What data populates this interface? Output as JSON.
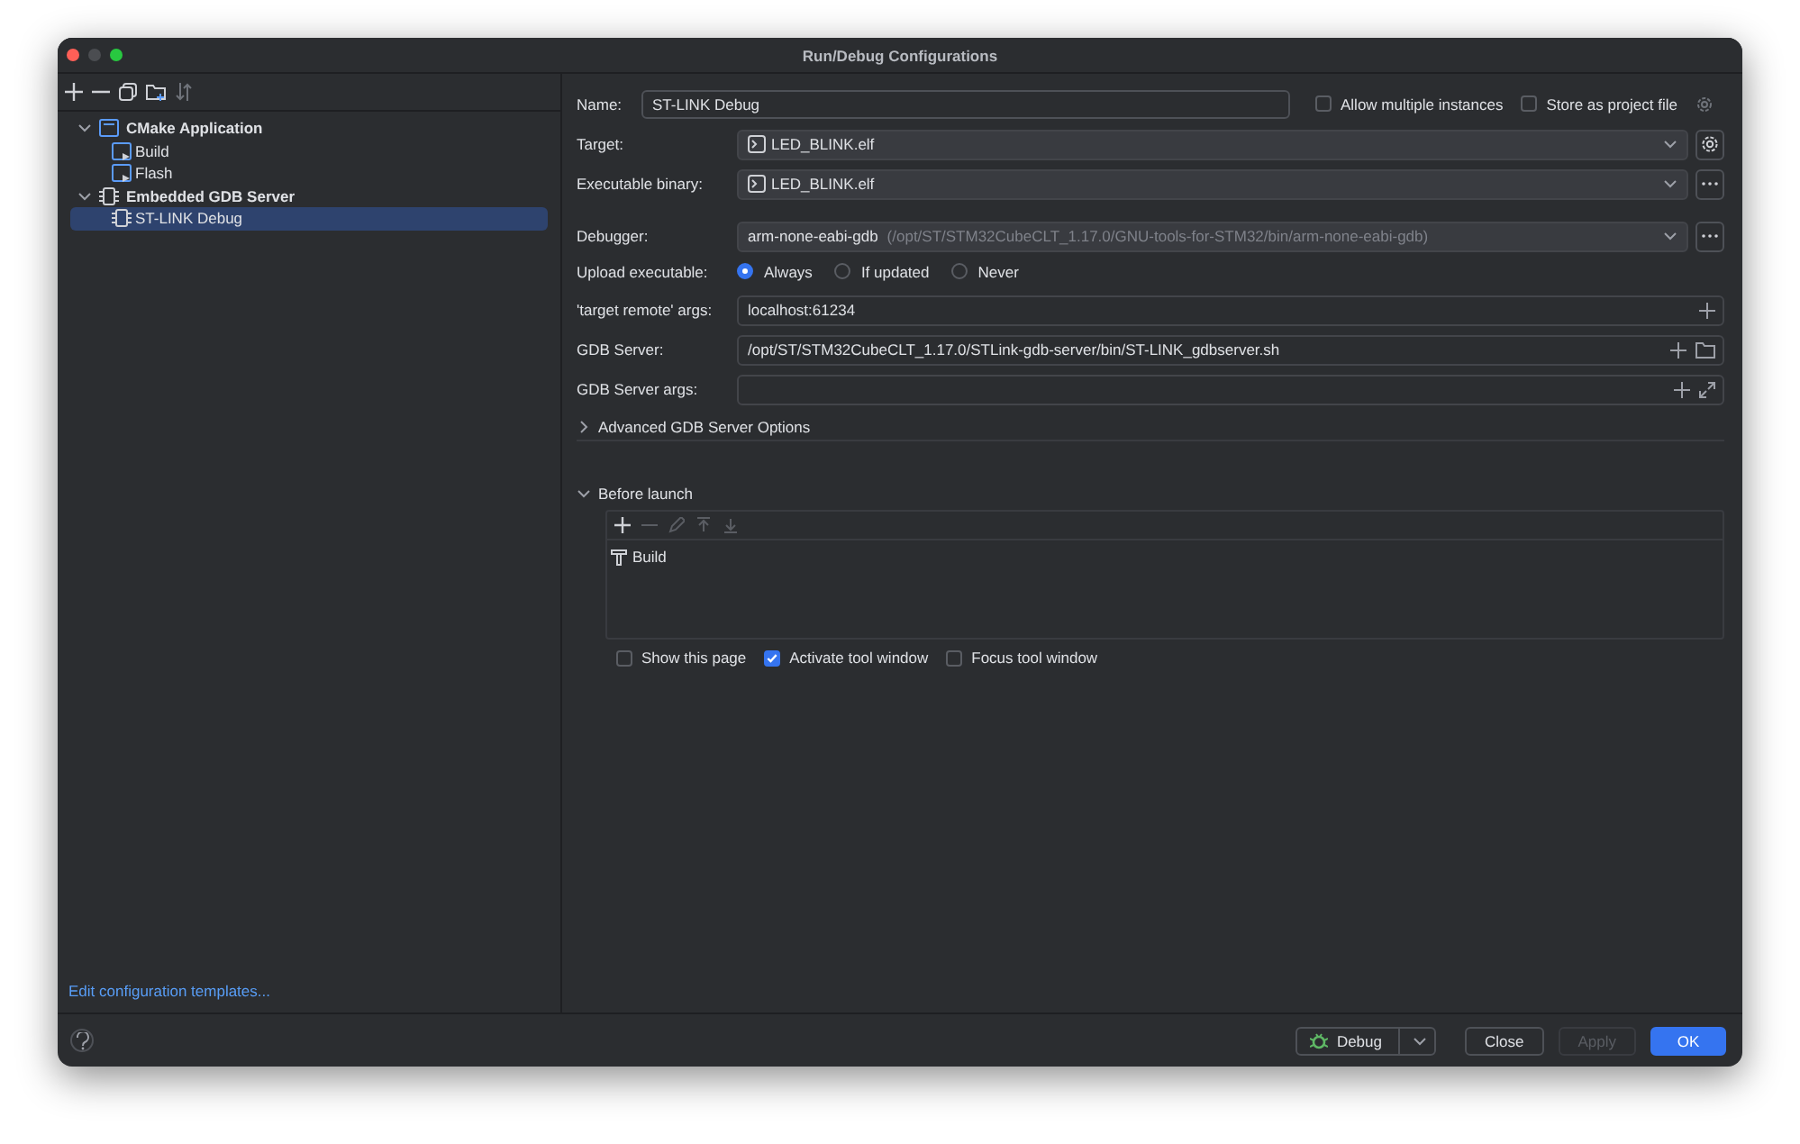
{
  "window": {
    "title": "Run/Debug Configurations"
  },
  "tree": [
    {
      "label": "CMake Application",
      "kind": "group",
      "expanded": true,
      "selected": false,
      "children": [
        {
          "label": "Build",
          "kind": "cmake",
          "selected": false
        },
        {
          "label": "Flash",
          "kind": "cmake",
          "selected": false
        }
      ]
    },
    {
      "label": "Embedded GDB Server",
      "kind": "chip",
      "expanded": true,
      "selected": false,
      "children": [
        {
          "label": "ST-LINK Debug",
          "kind": "chip",
          "selected": true
        }
      ]
    }
  ],
  "templates_link": "Edit configuration templates...",
  "name": {
    "label": "Name:",
    "value": "ST-LINK Debug"
  },
  "top_options": [
    {
      "label": "Allow multiple instances",
      "checked": false
    },
    {
      "label": "Store as project file",
      "checked": false
    }
  ],
  "rows": [
    {
      "kind": "combo",
      "label": "Target:",
      "value": "LED_BLINK.elf",
      "file_icon": true,
      "side": {
        "kind": "gear"
      }
    },
    {
      "kind": "combo",
      "label": "Executable binary:",
      "value": "LED_BLINK.elf",
      "file_icon": true,
      "side": {
        "kind": "more"
      }
    },
    {
      "kind": "combo",
      "label": "Debugger:",
      "value": "arm-none-eabi-gdb",
      "hint": "(/opt/ST/STM32CubeCLT_1.17.0/GNU-tools-for-STM32/bin/arm-none-eabi-gdb)",
      "file_icon": false,
      "side": {
        "kind": "more"
      }
    },
    {
      "kind": "radio",
      "label": "Upload executable:",
      "options": [
        {
          "label": "Always",
          "selected": true
        },
        {
          "label": "If updated",
          "selected": false
        },
        {
          "label": "Never",
          "selected": false
        }
      ]
    },
    {
      "kind": "text",
      "label": "'target remote' args:",
      "value": "localhost:61234",
      "buttons": [
        {
          "kind": "plus"
        }
      ]
    },
    {
      "kind": "text",
      "label": "GDB Server:",
      "value": "/opt/ST/STM32CubeCLT_1.17.0/STLink-gdb-server/bin/ST-LINK_gdbserver.sh",
      "buttons": [
        {
          "kind": "plus"
        },
        {
          "kind": "folder"
        }
      ]
    },
    {
      "kind": "text",
      "label": "GDB Server args:",
      "buttons": [
        {
          "kind": "plus"
        },
        {
          "kind": "expand"
        }
      ]
    }
  ],
  "advanced": {
    "label": "Advanced GDB Server Options",
    "expanded": false
  },
  "before_launch": {
    "label": "Before launch",
    "expanded": true,
    "tasks": [
      {
        "label": "Build"
      }
    ]
  },
  "launch_options": [
    {
      "label": "Show this page",
      "checked": false
    },
    {
      "label": "Activate tool window",
      "checked": true
    },
    {
      "label": "Focus tool window",
      "checked": false
    }
  ],
  "buttons": [
    {
      "label": "Debug",
      "kind": "run"
    },
    {
      "label": "Close",
      "kind": "normal",
      "disabled": false
    },
    {
      "label": "Apply",
      "kind": "normal",
      "disabled": true
    },
    {
      "label": "OK",
      "kind": "primary",
      "disabled": false
    }
  ]
}
